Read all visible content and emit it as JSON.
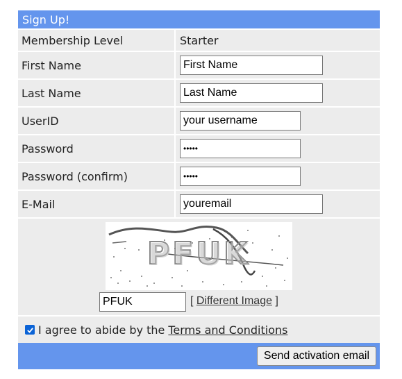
{
  "form": {
    "header": "Sign Up!",
    "membership": {
      "label": "Membership Level",
      "value": "Starter"
    },
    "first_name": {
      "label": "First Name",
      "value": "First Name"
    },
    "last_name": {
      "label": "Last Name",
      "value": "Last Name"
    },
    "userid": {
      "label": "UserID",
      "value": "your username"
    },
    "password": {
      "label": "Password",
      "value": "•••••"
    },
    "password_confirm": {
      "label": "Password (confirm)",
      "value": "•••••"
    },
    "email": {
      "label": "E-Mail",
      "value": "youremail"
    },
    "captcha": {
      "image_text": "PFUK",
      "input_value": "PFUK",
      "link_open": "[",
      "link_label": "Different Image",
      "link_close": "]"
    },
    "agree": {
      "checked": true,
      "text": "I agree to abide by the",
      "terms_link": "Terms and Conditions"
    },
    "submit_label": "Send activation email"
  },
  "colors": {
    "header_bg": "#6495ed",
    "row_bg": "#ececec",
    "checkbox": "#0b63d6"
  }
}
